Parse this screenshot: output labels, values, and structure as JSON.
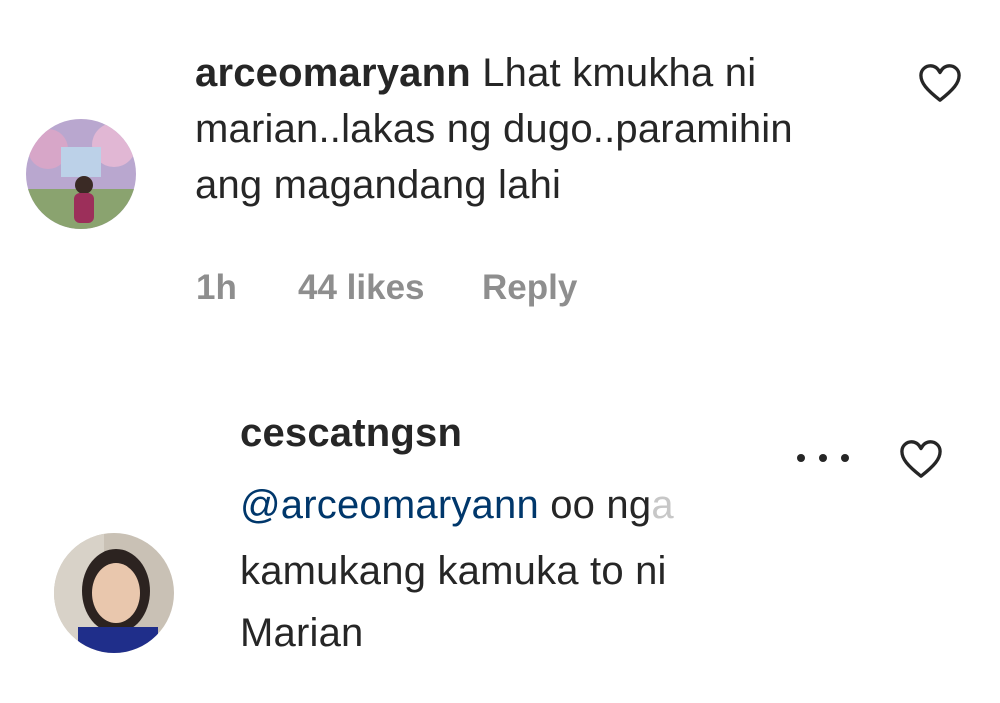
{
  "comment1": {
    "username": "arceomaryann",
    "line1": "Lhat kmukha ni",
    "line2": "marian..lakas ng dugo..paramihin",
    "line3": "ang magandang lahi",
    "time": "1h",
    "likes": "44 likes",
    "reply_label": "Reply",
    "icons": {
      "like": "heart-outline-icon"
    }
  },
  "comment2": {
    "username": "cescatngsn",
    "mention": "@arceomaryann",
    "line1_rest": "oo ng",
    "line1_faded": "a",
    "line2": "kamukang kamuka to ni",
    "line3": "Marian",
    "icons": {
      "more": "more-options-icon",
      "like": "heart-outline-icon"
    }
  },
  "colors": {
    "text": "#262626",
    "meta": "#8e8e8e",
    "mention": "#00376b"
  }
}
